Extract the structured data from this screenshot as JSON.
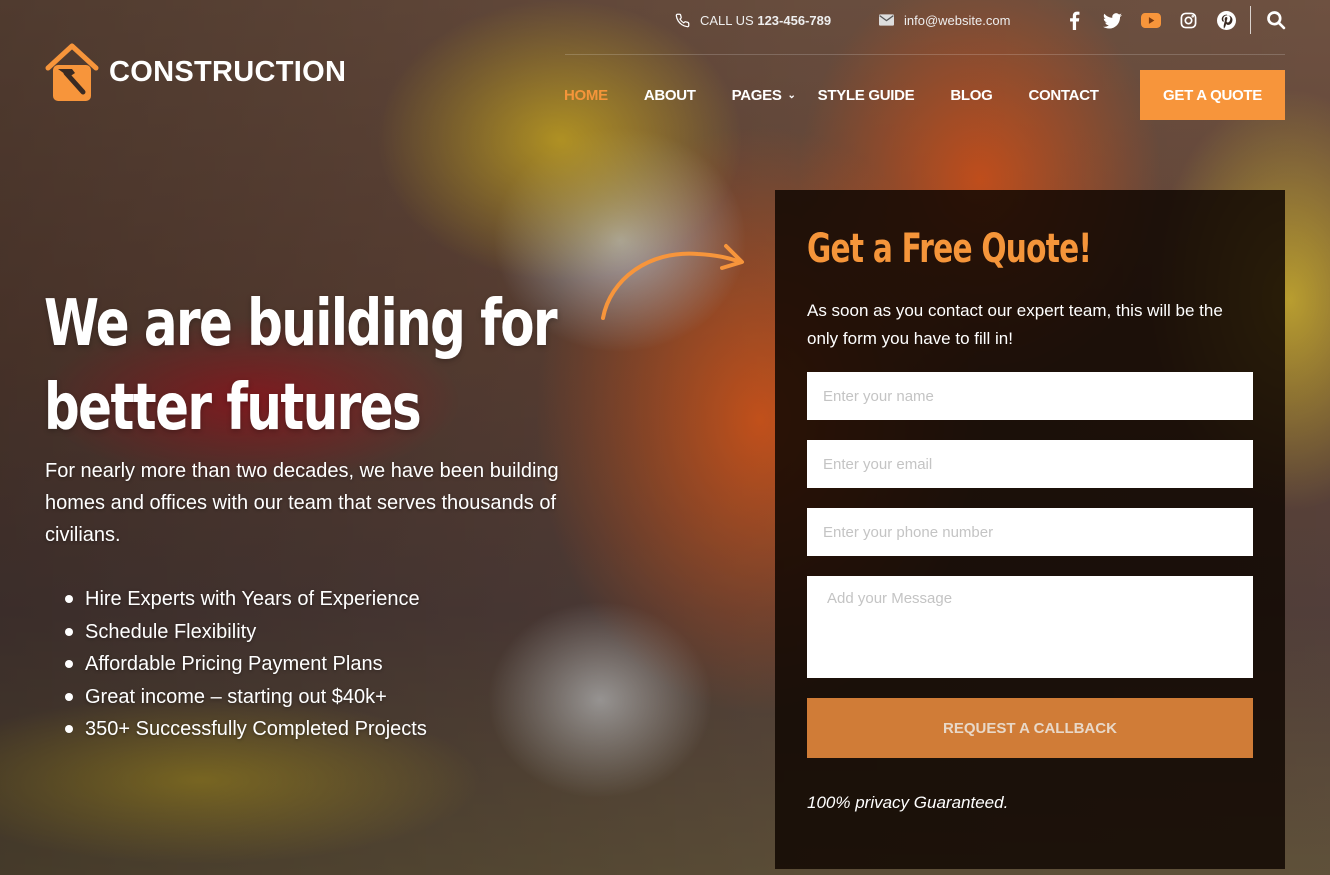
{
  "topbar": {
    "call_prefix": "CALL US",
    "phone": "123-456-789",
    "email": "info@website.com",
    "social": [
      "facebook",
      "twitter",
      "youtube",
      "instagram",
      "pinterest"
    ]
  },
  "logo": {
    "text": "CONSTRUCTION"
  },
  "nav": {
    "items": [
      {
        "label": "HOME",
        "active": true
      },
      {
        "label": "ABOUT"
      },
      {
        "label": "PAGES",
        "has_dropdown": true
      },
      {
        "label": "STYLE GUIDE"
      },
      {
        "label": "BLOG"
      },
      {
        "label": "CONTACT"
      }
    ],
    "cta": "GET A QUOTE"
  },
  "hero": {
    "headline_line1": "We are building for",
    "headline_line2": "better futures",
    "lead": "For nearly more than two decades, we have been building homes and offices with our team that serves thousands of civilians.",
    "features": [
      "Hire Experts with Years of Experience",
      "Schedule Flexibility",
      "Affordable Pricing Payment Plans",
      "Great income – starting out $40k+",
      "350+ Successfully Completed Projects"
    ]
  },
  "form": {
    "title": "Get a Free Quote!",
    "description": "As soon as you contact our expert team, this will be the only form you have to fill in!",
    "name_placeholder": "Enter your name",
    "email_placeholder": "Enter your email",
    "phone_placeholder": "Enter your phone number",
    "message_placeholder": "Add your Message",
    "submit_label": "REQUEST A CALLBACK",
    "privacy_note": "100% privacy Guaranteed."
  },
  "colors": {
    "accent": "#f7953b",
    "button_muted": "#d07c37",
    "panel_bg": "#120802"
  }
}
